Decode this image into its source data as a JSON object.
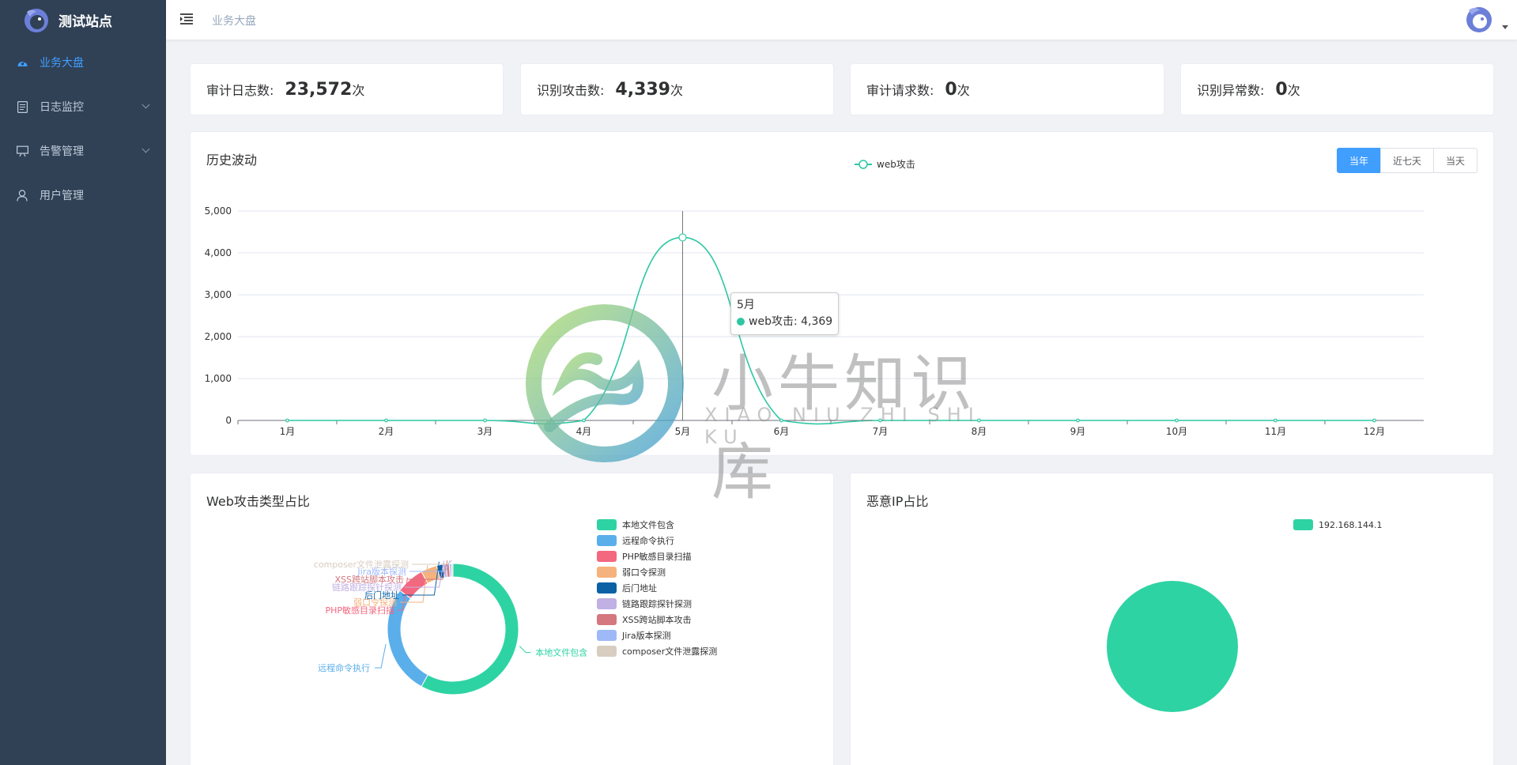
{
  "sidebar": {
    "title": "测试站点",
    "items": [
      {
        "label": "业务大盘",
        "icon": "dashboard-icon",
        "active": true
      },
      {
        "label": "日志监控",
        "icon": "document-icon",
        "expandable": true
      },
      {
        "label": "告警管理",
        "icon": "easel-icon",
        "expandable": true
      },
      {
        "label": "用户管理",
        "icon": "user-icon"
      }
    ]
  },
  "navbar": {
    "breadcrumb": "业务大盘"
  },
  "stats": [
    {
      "label": "审计日志数:",
      "value": "23,572",
      "unit": "次"
    },
    {
      "label": "识别攻击数:",
      "value": "4,339",
      "unit": "次"
    },
    {
      "label": "审计请求数:",
      "value": "0",
      "unit": "次"
    },
    {
      "label": "识别异常数:",
      "value": "0",
      "unit": "次"
    }
  ],
  "history": {
    "title": "历史波动",
    "buttons": [
      "当年",
      "近七天",
      "当天"
    ],
    "active_button": "当年",
    "tooltip": {
      "month": "5月",
      "series": "web攻击",
      "value": "4,369"
    }
  },
  "attack_types": {
    "title": "Web攻击类型占比"
  },
  "malicious_ip": {
    "title": "恶意IP占比"
  },
  "watermark": {
    "text": "小牛知识库",
    "sub": "XIAO NIU ZHI SHI KU"
  },
  "colors": {
    "sidebar_bg": "#304156",
    "accent": "#409eff",
    "series": "#2ec7a3"
  },
  "chart_data": [
    {
      "type": "line",
      "title": "",
      "legend_position": "top-center",
      "x": [
        "1月",
        "2月",
        "3月",
        "4月",
        "5月",
        "6月",
        "7月",
        "8月",
        "9月",
        "10月",
        "11月",
        "12月"
      ],
      "series": [
        {
          "name": "web攻击",
          "values": [
            0,
            0,
            0,
            0,
            4369,
            0,
            0,
            0,
            0,
            0,
            0,
            0
          ]
        }
      ],
      "yticks": [
        "0",
        "1,000",
        "2,000",
        "3,000",
        "4,000",
        "5,000"
      ],
      "ylim": [
        0,
        5000
      ],
      "grid": true
    },
    {
      "type": "pie",
      "variant": "donut",
      "legend_position": "right",
      "slices": [
        {
          "name": "本地文件包含",
          "value": 58,
          "color": "#2ed3a3"
        },
        {
          "name": "远程命令执行",
          "value": 27,
          "color": "#5aaeea"
        },
        {
          "name": "PHP敏感目录扫描",
          "value": 7,
          "color": "#f3677f"
        },
        {
          "name": "弱口令探测",
          "value": 4,
          "color": "#f6b27c"
        },
        {
          "name": "后门地址",
          "value": 1.5,
          "color": "#0b61a4"
        },
        {
          "name": "链路跟踪探针探测",
          "value": 0.8,
          "color": "#c0b0e3"
        },
        {
          "name": "XSS跨站脚本攻击",
          "value": 0.8,
          "color": "#d4777e"
        },
        {
          "name": "Jira版本探测",
          "value": 0.5,
          "color": "#9fb8f8"
        },
        {
          "name": "composer文件泄露探测",
          "value": 0.4,
          "color": "#d8cdc0"
        }
      ]
    },
    {
      "type": "pie",
      "legend_position": "top-right",
      "slices": [
        {
          "name": "192.168.144.1",
          "value": 100,
          "color": "#2ed3a3"
        }
      ]
    }
  ]
}
